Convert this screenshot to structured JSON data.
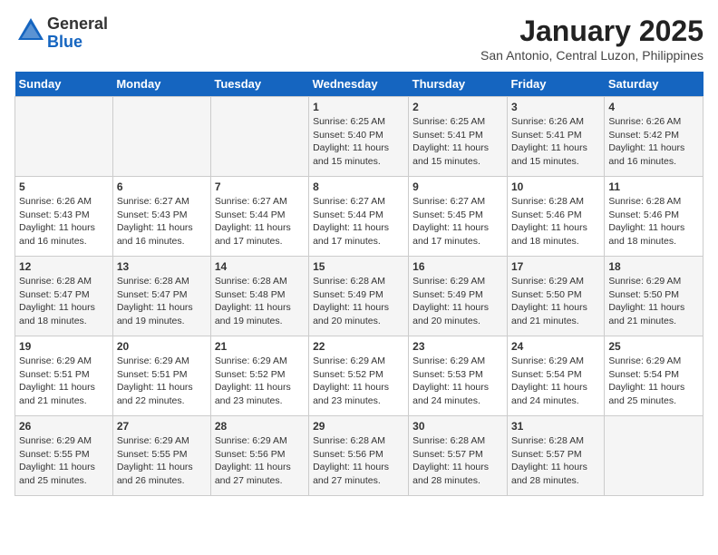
{
  "logo": {
    "general": "General",
    "blue": "Blue"
  },
  "header": {
    "month": "January 2025",
    "location": "San Antonio, Central Luzon, Philippines"
  },
  "days_of_week": [
    "Sunday",
    "Monday",
    "Tuesday",
    "Wednesday",
    "Thursday",
    "Friday",
    "Saturday"
  ],
  "weeks": [
    [
      {
        "day": "",
        "content": ""
      },
      {
        "day": "",
        "content": ""
      },
      {
        "day": "",
        "content": ""
      },
      {
        "day": "1",
        "content": "Sunrise: 6:25 AM\nSunset: 5:40 PM\nDaylight: 11 hours and 15 minutes."
      },
      {
        "day": "2",
        "content": "Sunrise: 6:25 AM\nSunset: 5:41 PM\nDaylight: 11 hours and 15 minutes."
      },
      {
        "day": "3",
        "content": "Sunrise: 6:26 AM\nSunset: 5:41 PM\nDaylight: 11 hours and 15 minutes."
      },
      {
        "day": "4",
        "content": "Sunrise: 6:26 AM\nSunset: 5:42 PM\nDaylight: 11 hours and 16 minutes."
      }
    ],
    [
      {
        "day": "5",
        "content": "Sunrise: 6:26 AM\nSunset: 5:43 PM\nDaylight: 11 hours and 16 minutes."
      },
      {
        "day": "6",
        "content": "Sunrise: 6:27 AM\nSunset: 5:43 PM\nDaylight: 11 hours and 16 minutes."
      },
      {
        "day": "7",
        "content": "Sunrise: 6:27 AM\nSunset: 5:44 PM\nDaylight: 11 hours and 17 minutes."
      },
      {
        "day": "8",
        "content": "Sunrise: 6:27 AM\nSunset: 5:44 PM\nDaylight: 11 hours and 17 minutes."
      },
      {
        "day": "9",
        "content": "Sunrise: 6:27 AM\nSunset: 5:45 PM\nDaylight: 11 hours and 17 minutes."
      },
      {
        "day": "10",
        "content": "Sunrise: 6:28 AM\nSunset: 5:46 PM\nDaylight: 11 hours and 18 minutes."
      },
      {
        "day": "11",
        "content": "Sunrise: 6:28 AM\nSunset: 5:46 PM\nDaylight: 11 hours and 18 minutes."
      }
    ],
    [
      {
        "day": "12",
        "content": "Sunrise: 6:28 AM\nSunset: 5:47 PM\nDaylight: 11 hours and 18 minutes."
      },
      {
        "day": "13",
        "content": "Sunrise: 6:28 AM\nSunset: 5:47 PM\nDaylight: 11 hours and 19 minutes."
      },
      {
        "day": "14",
        "content": "Sunrise: 6:28 AM\nSunset: 5:48 PM\nDaylight: 11 hours and 19 minutes."
      },
      {
        "day": "15",
        "content": "Sunrise: 6:28 AM\nSunset: 5:49 PM\nDaylight: 11 hours and 20 minutes."
      },
      {
        "day": "16",
        "content": "Sunrise: 6:29 AM\nSunset: 5:49 PM\nDaylight: 11 hours and 20 minutes."
      },
      {
        "day": "17",
        "content": "Sunrise: 6:29 AM\nSunset: 5:50 PM\nDaylight: 11 hours and 21 minutes."
      },
      {
        "day": "18",
        "content": "Sunrise: 6:29 AM\nSunset: 5:50 PM\nDaylight: 11 hours and 21 minutes."
      }
    ],
    [
      {
        "day": "19",
        "content": "Sunrise: 6:29 AM\nSunset: 5:51 PM\nDaylight: 11 hours and 21 minutes."
      },
      {
        "day": "20",
        "content": "Sunrise: 6:29 AM\nSunset: 5:51 PM\nDaylight: 11 hours and 22 minutes."
      },
      {
        "day": "21",
        "content": "Sunrise: 6:29 AM\nSunset: 5:52 PM\nDaylight: 11 hours and 23 minutes."
      },
      {
        "day": "22",
        "content": "Sunrise: 6:29 AM\nSunset: 5:52 PM\nDaylight: 11 hours and 23 minutes."
      },
      {
        "day": "23",
        "content": "Sunrise: 6:29 AM\nSunset: 5:53 PM\nDaylight: 11 hours and 24 minutes."
      },
      {
        "day": "24",
        "content": "Sunrise: 6:29 AM\nSunset: 5:54 PM\nDaylight: 11 hours and 24 minutes."
      },
      {
        "day": "25",
        "content": "Sunrise: 6:29 AM\nSunset: 5:54 PM\nDaylight: 11 hours and 25 minutes."
      }
    ],
    [
      {
        "day": "26",
        "content": "Sunrise: 6:29 AM\nSunset: 5:55 PM\nDaylight: 11 hours and 25 minutes."
      },
      {
        "day": "27",
        "content": "Sunrise: 6:29 AM\nSunset: 5:55 PM\nDaylight: 11 hours and 26 minutes."
      },
      {
        "day": "28",
        "content": "Sunrise: 6:29 AM\nSunset: 5:56 PM\nDaylight: 11 hours and 27 minutes."
      },
      {
        "day": "29",
        "content": "Sunrise: 6:28 AM\nSunset: 5:56 PM\nDaylight: 11 hours and 27 minutes."
      },
      {
        "day": "30",
        "content": "Sunrise: 6:28 AM\nSunset: 5:57 PM\nDaylight: 11 hours and 28 minutes."
      },
      {
        "day": "31",
        "content": "Sunrise: 6:28 AM\nSunset: 5:57 PM\nDaylight: 11 hours and 28 minutes."
      },
      {
        "day": "",
        "content": ""
      }
    ]
  ]
}
